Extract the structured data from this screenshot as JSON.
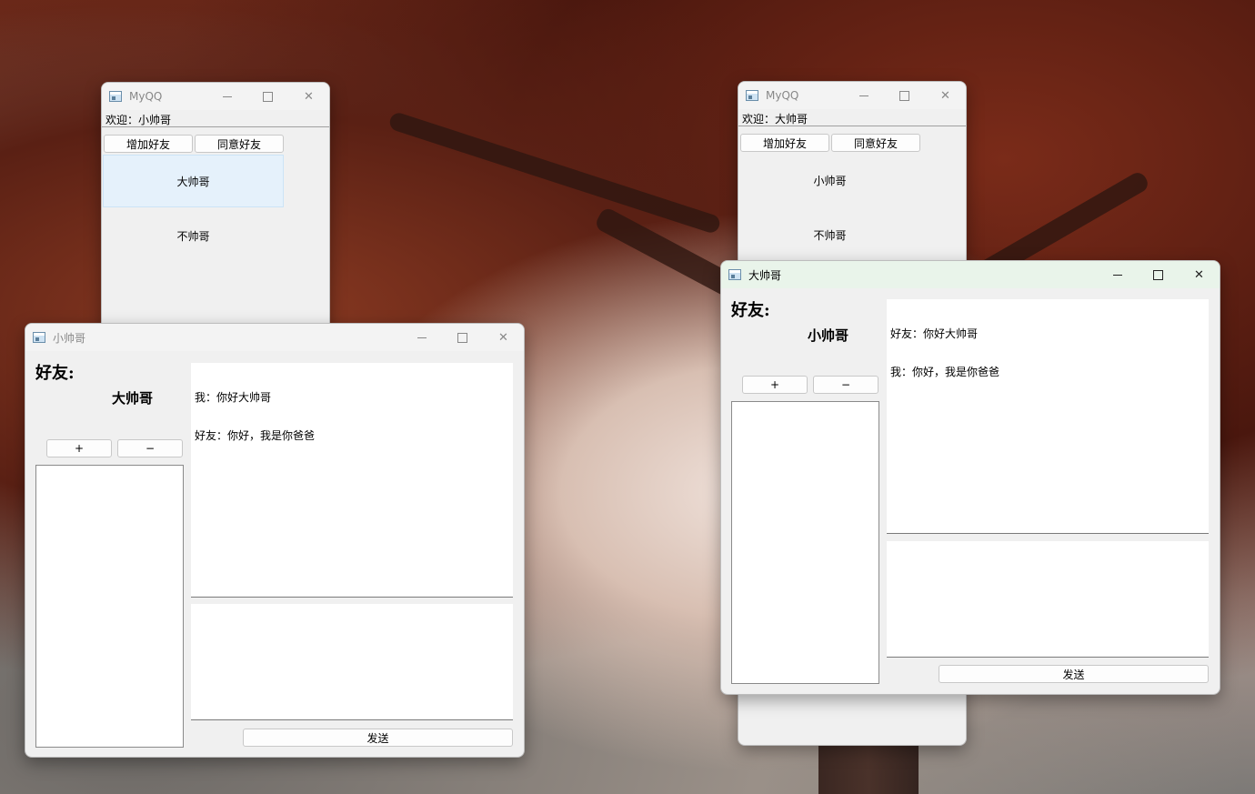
{
  "main_left": {
    "title": "MyQQ",
    "welcome": "欢迎：小帅哥",
    "add_friend": "增加好友",
    "accept_friend": "同意好友",
    "friends": [
      "大帅哥",
      "不帅哥"
    ]
  },
  "main_right": {
    "title": "MyQQ",
    "welcome": "欢迎：大帅哥",
    "add_friend": "增加好友",
    "accept_friend": "同意好友",
    "friends": [
      "小帅哥",
      "不帅哥"
    ]
  },
  "chat_left": {
    "title": "小帅哥",
    "friend_label": "好友:",
    "friend_name": "大帅哥",
    "plus": "+",
    "minus": "−",
    "messages": [
      "我：你好大帅哥",
      "好友：你好，我是你爸爸"
    ],
    "send": "发送"
  },
  "chat_right": {
    "title": "大帅哥",
    "friend_label": "好友:",
    "friend_name": "小帅哥",
    "plus": "+",
    "minus": "−",
    "messages": [
      "好友：你好大帅哥",
      "我：你好，我是你爸爸"
    ],
    "send": "发送"
  },
  "caption": {
    "minimize": "—",
    "maximize": "□",
    "close": "✕"
  }
}
